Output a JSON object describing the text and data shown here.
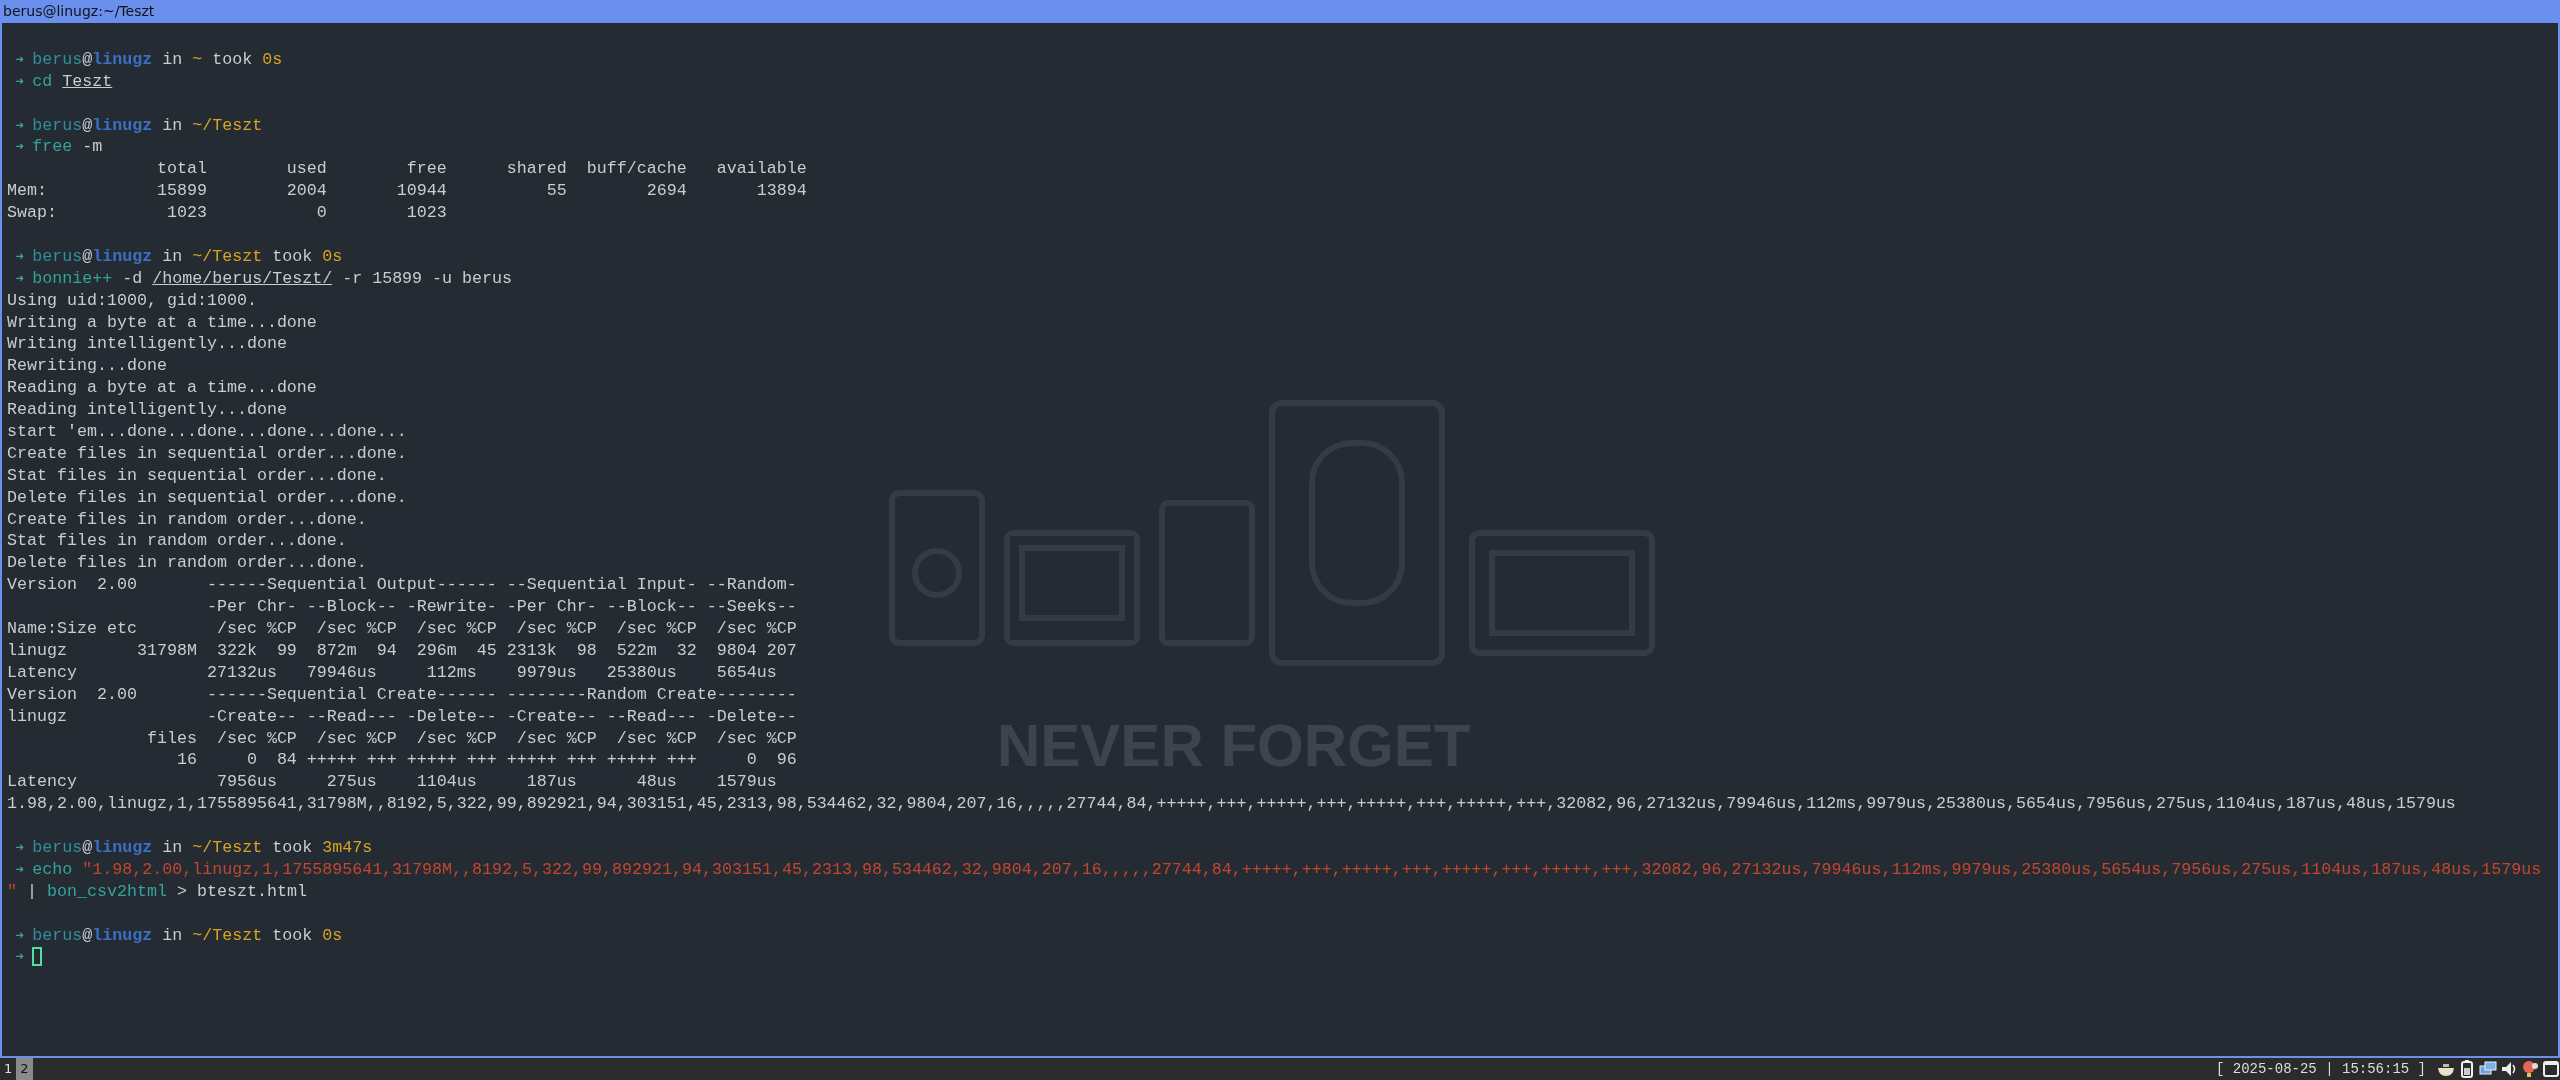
{
  "window": {
    "title": "berus@linugz:~/Teszt"
  },
  "terminal": {
    "blocks": [
      {
        "lines": [
          [
            {
              "kind": "arrow",
              "text": "➜"
            },
            {
              "kind": "user",
              "text": "berus"
            },
            {
              "kind": "plain",
              "text": "@"
            },
            {
              "kind": "host",
              "text": "linugz"
            },
            {
              "kind": "plain",
              "text": " in "
            },
            {
              "kind": "path",
              "text": "~"
            },
            {
              "kind": "plain",
              "text": " took "
            },
            {
              "kind": "path",
              "text": "0s"
            }
          ],
          [
            {
              "kind": "arrow",
              "text": "➜"
            },
            {
              "kind": "cmd",
              "text": "cd "
            },
            {
              "kind": "underline",
              "text": "Teszt"
            }
          ]
        ]
      },
      {
        "lines": [
          [
            {
              "kind": "arrow",
              "text": "➜"
            },
            {
              "kind": "user",
              "text": "berus"
            },
            {
              "kind": "plain",
              "text": "@"
            },
            {
              "kind": "host",
              "text": "linugz"
            },
            {
              "kind": "plain",
              "text": " in "
            },
            {
              "kind": "path",
              "text": "~/Teszt"
            }
          ],
          [
            {
              "kind": "arrow",
              "text": "➜"
            },
            {
              "kind": "cmd",
              "text": "free"
            },
            {
              "kind": "plain",
              "text": " -m"
            }
          ],
          [
            {
              "kind": "plain",
              "text": "               total        used        free      shared  buff/cache   available"
            }
          ],
          [
            {
              "kind": "plain",
              "text": "Mem:           15899        2004       10944          55        2694       13894"
            }
          ],
          [
            {
              "kind": "plain",
              "text": "Swap:           1023           0        1023"
            }
          ]
        ]
      },
      {
        "lines": [
          [
            {
              "kind": "arrow",
              "text": "➜"
            },
            {
              "kind": "user",
              "text": "berus"
            },
            {
              "kind": "plain",
              "text": "@"
            },
            {
              "kind": "host",
              "text": "linugz"
            },
            {
              "kind": "plain",
              "text": " in "
            },
            {
              "kind": "path",
              "text": "~/Teszt"
            },
            {
              "kind": "plain",
              "text": " took "
            },
            {
              "kind": "path",
              "text": "0s"
            }
          ],
          [
            {
              "kind": "arrow",
              "text": "➜"
            },
            {
              "kind": "cmd",
              "text": "bonnie++"
            },
            {
              "kind": "plain",
              "text": " -d "
            },
            {
              "kind": "underline",
              "text": "/home/berus/Teszt/"
            },
            {
              "kind": "plain",
              "text": " -r 15899 -u berus"
            }
          ],
          [
            {
              "kind": "plain",
              "text": "Using uid:1000, gid:1000."
            }
          ],
          [
            {
              "kind": "plain",
              "text": "Writing a byte at a time...done"
            }
          ],
          [
            {
              "kind": "plain",
              "text": "Writing intelligently...done"
            }
          ],
          [
            {
              "kind": "plain",
              "text": "Rewriting...done"
            }
          ],
          [
            {
              "kind": "plain",
              "text": "Reading a byte at a time...done"
            }
          ],
          [
            {
              "kind": "plain",
              "text": "Reading intelligently...done"
            }
          ],
          [
            {
              "kind": "plain",
              "text": "start 'em...done...done...done...done..."
            }
          ],
          [
            {
              "kind": "plain",
              "text": "Create files in sequential order...done."
            }
          ],
          [
            {
              "kind": "plain",
              "text": "Stat files in sequential order...done."
            }
          ],
          [
            {
              "kind": "plain",
              "text": "Delete files in sequential order...done."
            }
          ],
          [
            {
              "kind": "plain",
              "text": "Create files in random order...done."
            }
          ],
          [
            {
              "kind": "plain",
              "text": "Stat files in random order...done."
            }
          ],
          [
            {
              "kind": "plain",
              "text": "Delete files in random order...done."
            }
          ],
          [
            {
              "kind": "plain",
              "text": "Version  2.00       ------Sequential Output------ --Sequential Input- --Random-"
            }
          ],
          [
            {
              "kind": "plain",
              "text": "                    -Per Chr- --Block-- -Rewrite- -Per Chr- --Block-- --Seeks--"
            }
          ],
          [
            {
              "kind": "plain",
              "text": "Name:Size etc        /sec %CP  /sec %CP  /sec %CP  /sec %CP  /sec %CP  /sec %CP"
            }
          ],
          [
            {
              "kind": "plain",
              "text": "linugz       31798M  322k  99  872m  94  296m  45 2313k  98  522m  32  9804 207"
            }
          ],
          [
            {
              "kind": "plain",
              "text": "Latency             27132us   79946us     112ms    9979us   25380us    5654us"
            }
          ],
          [
            {
              "kind": "plain",
              "text": "Version  2.00       ------Sequential Create------ --------Random Create--------"
            }
          ],
          [
            {
              "kind": "plain",
              "text": "linugz              -Create-- --Read--- -Delete-- -Create-- --Read--- -Delete--"
            }
          ],
          [
            {
              "kind": "plain",
              "text": "              files  /sec %CP  /sec %CP  /sec %CP  /sec %CP  /sec %CP  /sec %CP"
            }
          ],
          [
            {
              "kind": "plain",
              "text": "                 16     0  84 +++++ +++ +++++ +++ +++++ +++ +++++ +++     0  96"
            }
          ],
          [
            {
              "kind": "plain",
              "text": "Latency              7956us     275us    1104us     187us      48us    1579us"
            }
          ],
          [
            {
              "kind": "plain",
              "text": "1.98,2.00,linugz,1,1755895641,31798M,,8192,5,322,99,892921,94,303151,45,2313,98,534462,32,9804,207,16,,,,,27744,84,+++++,+++,+++++,+++,+++++,+++,+++++,+++,32082,96,27132us,79946us,112ms,9979us,25380us,5654us,7956us,275us,1104us,187us,48us,1579us"
            }
          ]
        ]
      },
      {
        "lines": [
          [
            {
              "kind": "arrow",
              "text": "➜"
            },
            {
              "kind": "user",
              "text": "berus"
            },
            {
              "kind": "plain",
              "text": "@"
            },
            {
              "kind": "host",
              "text": "linugz"
            },
            {
              "kind": "plain",
              "text": " in "
            },
            {
              "kind": "path",
              "text": "~/Teszt"
            },
            {
              "kind": "plain",
              "text": " took "
            },
            {
              "kind": "path",
              "text": "3m47s"
            }
          ],
          [
            {
              "kind": "arrow",
              "text": "➜"
            },
            {
              "kind": "cmd",
              "text": "echo"
            },
            {
              "kind": "string",
              "text": " \"1.98,2.00,linugz,1,1755895641,31798M,,8192,5,322,99,892921,94,303151,45,2313,98,534462,32,9804,207,16,,,,,27744,84,+++++,+++,+++++,+++,+++++,+++,+++++,+++,32082,96,27132us,79946us,112ms,9979us,25380us,5654us,7956us,275us,1104us,187us,48us,1579us"
            }
          ],
          [
            {
              "kind": "string",
              "text": "\""
            },
            {
              "kind": "plain",
              "text": " | "
            },
            {
              "kind": "cmd",
              "text": "bon_csv2html"
            },
            {
              "kind": "plain",
              "text": " > bteszt.html"
            }
          ]
        ]
      },
      {
        "lines": [
          [
            {
              "kind": "arrow",
              "text": "➜"
            },
            {
              "kind": "user",
              "text": "berus"
            },
            {
              "kind": "plain",
              "text": "@"
            },
            {
              "kind": "host",
              "text": "linugz"
            },
            {
              "kind": "plain",
              "text": " in "
            },
            {
              "kind": "path",
              "text": "~/Teszt"
            },
            {
              "kind": "plain",
              "text": " took "
            },
            {
              "kind": "path",
              "text": "0s"
            }
          ],
          [
            {
              "kind": "arrow",
              "text": "➜"
            },
            {
              "kind": "cursor"
            }
          ]
        ]
      }
    ],
    "wallpaper": {
      "caption": "NEVER FORGET"
    }
  },
  "taskbar": {
    "workspaces": [
      {
        "label": "1",
        "selected": false
      },
      {
        "label": "2",
        "selected": true
      }
    ],
    "clock": "[ 2025-08-25 | 15:56:15 ]"
  }
}
